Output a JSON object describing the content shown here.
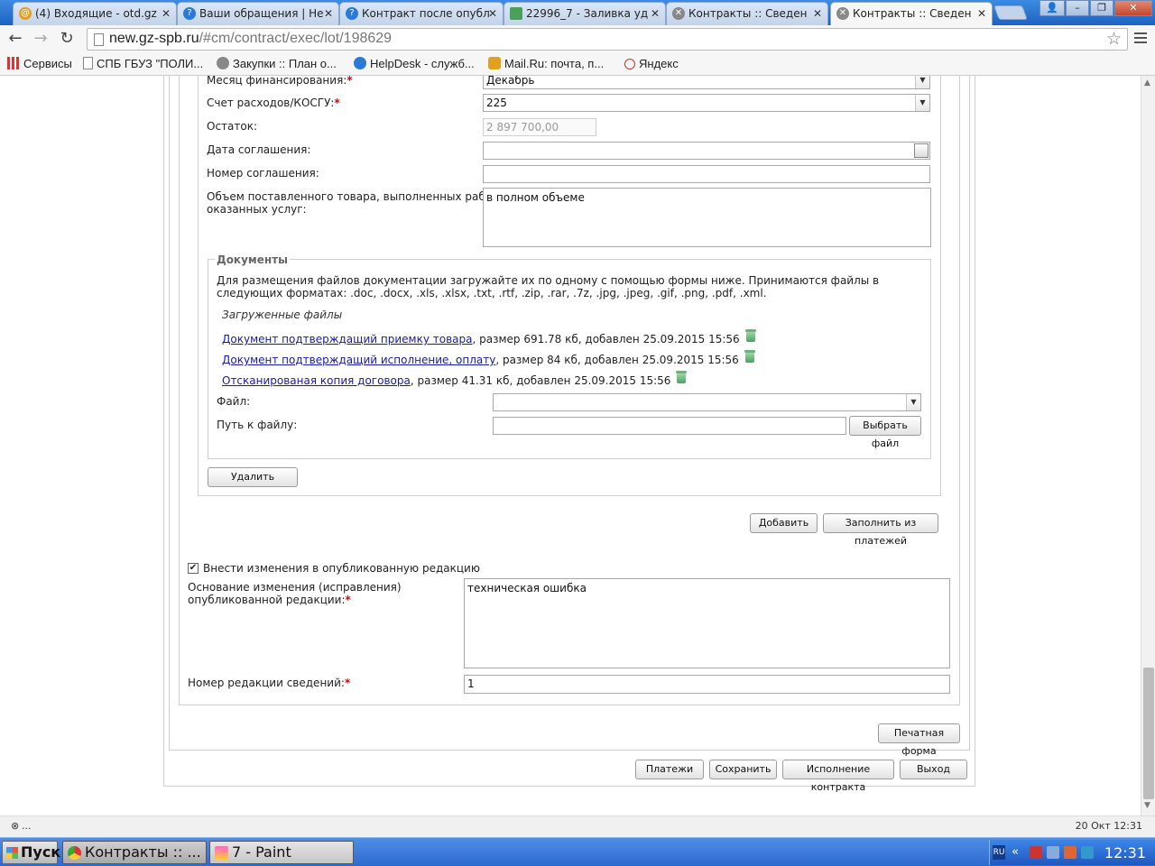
{
  "browser": {
    "tabs": [
      {
        "label": "(4) Входящие - otd.gz",
        "icon_color": "#e0a020",
        "active": false
      },
      {
        "label": "Ваши обращения | He",
        "icon_color": "#2a7ad8",
        "active": false
      },
      {
        "label": "Контракт после опубл",
        "icon_color": "#2a7ad8",
        "active": false
      },
      {
        "label": "22996_7 - Заливка уд",
        "icon_color": "#4aa05a",
        "active": false
      },
      {
        "label": "Контракты :: Сведен",
        "icon_color": "#888888",
        "active": false
      },
      {
        "label": "Контракты :: Сведен",
        "icon_color": "#888888",
        "active": true
      }
    ],
    "url_host": "new.gz-spb.ru",
    "url_path": "/#cm/contract/exec/lot/198629",
    "bookmarks": [
      {
        "label": "Сервисы",
        "icon_color": "#d33"
      },
      {
        "label": "СПБ ГБУЗ \"ПОЛИ...",
        "icon_color": "#ffffff"
      },
      {
        "label": "Закупки :: План о...",
        "icon_color": "#888888"
      },
      {
        "label": "HelpDesk - служб...",
        "icon_color": "#2a7ad8"
      },
      {
        "label": "Mail.Ru: почта, п...",
        "icon_color": "#e0a020"
      },
      {
        "label": "Яндекс",
        "icon_color": "#ffffff"
      }
    ]
  },
  "form": {
    "month_label": "Месяц финансирования:",
    "month_value": "Декабрь",
    "kosgu_label": "Счет расходов/КОСГУ:",
    "kosgu_value": "225",
    "remainder_label": "Остаток:",
    "remainder_value": "2 897 700,00",
    "agreement_date_label": "Дата соглашения:",
    "agreement_date_value": "",
    "agreement_number_label": "Номер соглашения:",
    "agreement_number_value": "",
    "volume_label_1": "Объем поставленного товара, выполненных работ,",
    "volume_label_2": "оказанных услуг:",
    "volume_value": "в полном объеме"
  },
  "documents": {
    "legend": "Документы",
    "hint": "Для размещения файлов документации загружайте их по одному с помощью формы ниже. Принимаются файлы в следующих форматах: .doc, .docx, .xls, .xlsx, .txt, .rtf, .zip, .rar, .7z, .jpg, .jpeg, .gif, .png, .pdf, .xml.",
    "uploaded_title": "Загруженные файлы",
    "files": [
      {
        "name": "Документ подтверждащий приемку товара",
        "meta": ", размер 691.78 кб, добавлен 25.09.2015 15:56"
      },
      {
        "name": "Документ подтверждащий исполнение, оплату",
        "meta": ", размер 84 кб, добавлен 25.09.2015 15:56"
      },
      {
        "name": "Отсканированая копия договора",
        "meta": ", размер 41.31 кб, добавлен 25.09.2015 15:56"
      }
    ],
    "file_label": "Файл:",
    "file_value": "",
    "path_label": "Путь к файлу:",
    "path_value": "",
    "choose_button": "Выбрать файл"
  },
  "buttons": {
    "delete": "Удалить",
    "add": "Добавить",
    "fill_from_payments": "Заполнить из платежей",
    "print_form": "Печатная форма",
    "payments": "Платежи",
    "save": "Сохранить",
    "contract_execution": "Исполнение контракта",
    "exit": "Выход"
  },
  "changes": {
    "checkbox_label": "Внести изменения в опубликованную редакцию",
    "checked": true,
    "reason_label_1": "Основание изменения (исправления)",
    "reason_label_2": "опубликованной редакции:",
    "reason_value": "техническая ошибка",
    "revision_label": "Номер редакции сведений:",
    "revision_value": "1"
  },
  "status": {
    "left": "...",
    "right": "20 Окт 12:31"
  },
  "taskbar": {
    "start": "Пуск",
    "tasks": [
      {
        "label": "Контракты :: ...",
        "active": true
      },
      {
        "label": "7 - Paint",
        "active": false
      }
    ],
    "lang": "RU",
    "clock": "12:31"
  }
}
